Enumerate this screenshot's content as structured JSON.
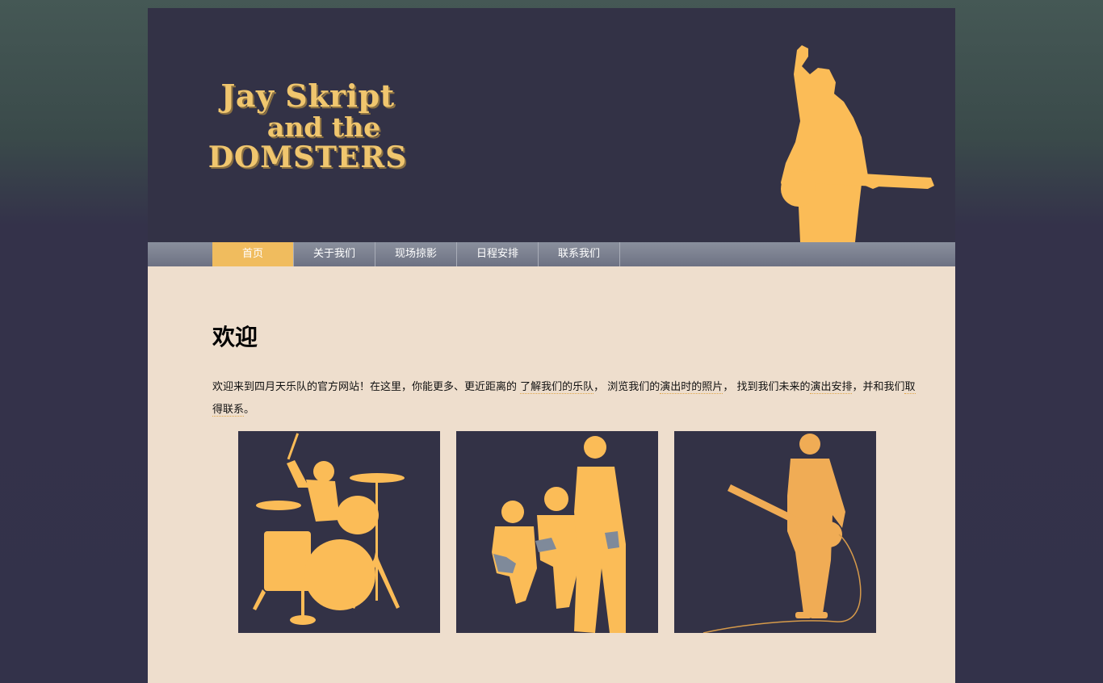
{
  "header": {
    "logo_line1": "Jay Skript",
    "logo_line2": "and the",
    "logo_line3": "DOMSTERS",
    "silhouette": "guitarist-silhouette"
  },
  "nav": {
    "items": [
      "首页",
      "关于我们",
      "现场掠影",
      "日程安排",
      "联系我们"
    ],
    "active": "首页"
  },
  "main": {
    "heading": "欢迎",
    "intro_part1": "欢迎来到四月天乐队的官方网站！在这里，你能更多、更近距离的 ",
    "link_about": "了解我们的乐队",
    "intro_part2": "， 浏览我们的",
    "link_photos": "演出时的照片",
    "intro_part3": "， 找到我们未来的",
    "link_schedule": "演出安排",
    "intro_part4": "，并和我们",
    "link_contact": "取得联系",
    "intro_part5": "。"
  },
  "gallery": [
    "drummer-silhouette",
    "band-group-silhouette",
    "bassist-silhouette"
  ],
  "colors": {
    "accent": "#f0bc5e",
    "silhouette": "#fbbc57",
    "header_bg": "#333246",
    "content_bg": "#eedecd",
    "nav_top": "#8a909d",
    "page_bg": "#33324a"
  }
}
